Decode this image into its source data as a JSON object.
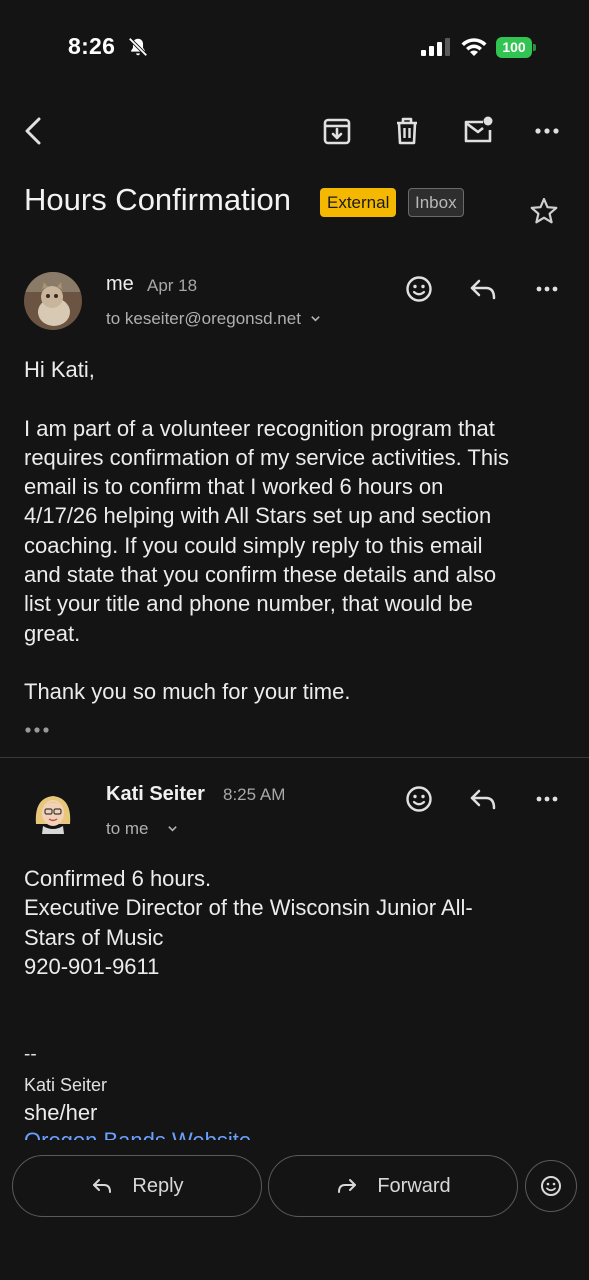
{
  "status_bar": {
    "time": "8:26",
    "battery": "100"
  },
  "toolbar": {
    "icons": [
      "back-icon",
      "archive-icon",
      "delete-icon",
      "mark-unread-icon",
      "more-icon"
    ]
  },
  "subject": {
    "title": "Hours Confirmation",
    "external_label": "External",
    "inbox_label": "Inbox"
  },
  "message1": {
    "sender": "me",
    "date": "Apr 18",
    "recipient": "to keseiter@oregonsd.net",
    "body": {
      "greeting": "Hi Kati,",
      "paragraph_lines": [
        "I am part of a volunteer recognition program that",
        "requires confirmation of my service activities. This",
        "email is to confirm that I worked 6 hours on",
        "4/17/26 helping with All Stars set up and section",
        "coaching. If you could simply reply to this email",
        "and state that you confirm these details and also",
        "list your title and phone number, that would be",
        "great."
      ],
      "closing": "Thank you so much for your time."
    }
  },
  "message2": {
    "sender": "Kati Seiter",
    "time": "8:25 AM",
    "recipient": "to me",
    "body": {
      "lines": [
        "Confirmed 6 hours.",
        "Executive Director of the Wisconsin Junior All-",
        "Stars of Music",
        "920-901-9611"
      ],
      "sig_separator": "--",
      "sig_name": "Kati Seiter",
      "sig_pronouns": "she/her",
      "sig_link": "Oregon Bands Website"
    }
  },
  "actions": {
    "reply_label": "Reply",
    "forward_label": "Forward"
  },
  "colors": {
    "background": "#141414",
    "external_chip": "#f5b800",
    "battery": "#31c452",
    "link": "#6aa1ff"
  }
}
